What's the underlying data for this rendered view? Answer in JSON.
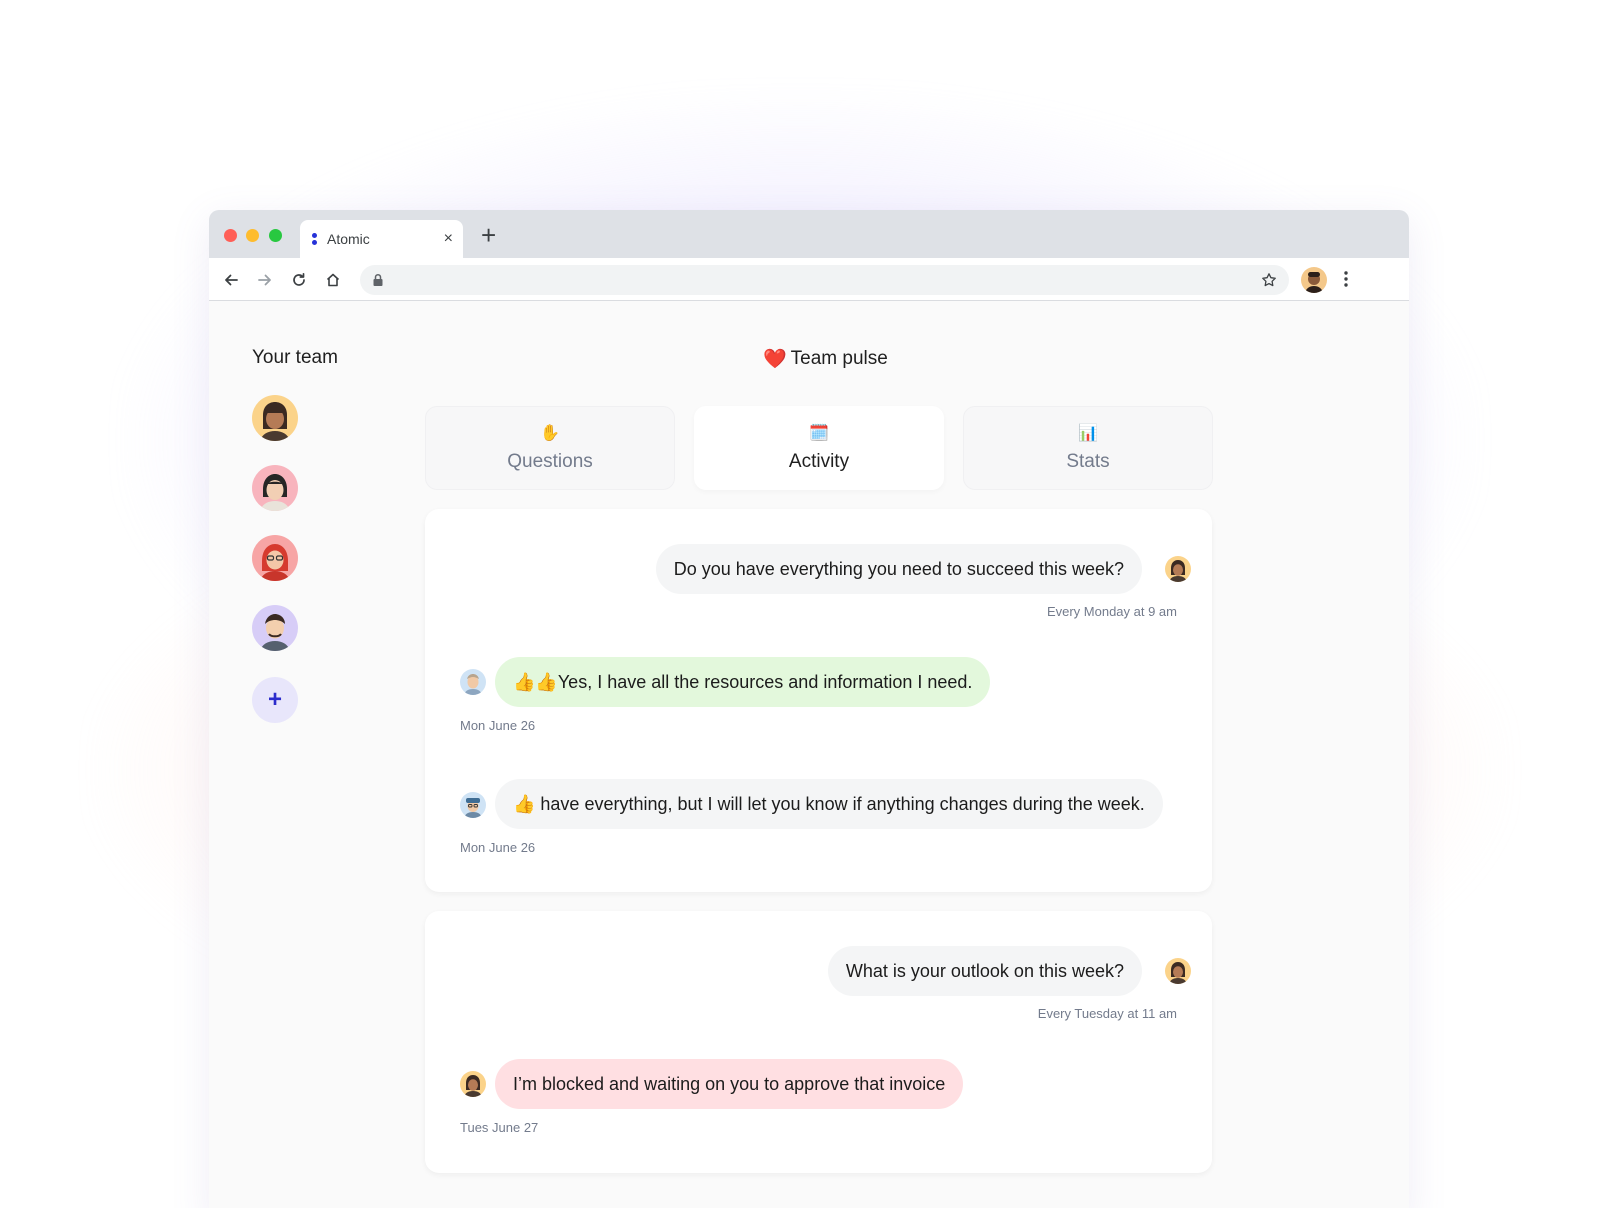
{
  "browser": {
    "tab_title": "Atomic",
    "tab_close": "×",
    "new_tab": "+"
  },
  "sidebar": {
    "title": "Your team",
    "members": [
      {
        "name": "member-1",
        "bg": "#fbd38a"
      },
      {
        "name": "member-2",
        "bg": "#f8b4bd"
      },
      {
        "name": "member-3",
        "bg": "#f7a5a5"
      },
      {
        "name": "member-4",
        "bg": "#d7cdf7"
      }
    ],
    "add_label": "+"
  },
  "main": {
    "title_emoji": "❤️",
    "title": "Team pulse",
    "tabs": [
      {
        "icon": "✋",
        "label": "Questions"
      },
      {
        "icon": "🗓️",
        "label": "Activity"
      },
      {
        "icon": "📊",
        "label": "Stats"
      }
    ]
  },
  "threads": [
    {
      "question": "Do you have everything you need to succeed this week?",
      "schedule": "Every Monday at 9 am",
      "answers": [
        {
          "text": "👍👍Yes, I have all the resources and information I need.",
          "date": "Mon June 26",
          "tone": "green"
        },
        {
          "text": "👍  have everything, but I will let you know if anything changes during the week.",
          "date": "Mon June 26",
          "tone": "grey"
        }
      ]
    },
    {
      "question": "What is your outlook on this week?",
      "schedule": "Every Tuesday at 11 am",
      "answers": [
        {
          "text": "I’m blocked and waiting on you to approve that invoice",
          "date": "Tues June 27",
          "tone": "pink"
        }
      ]
    }
  ],
  "colors": {
    "accent": "#2632d8",
    "green_bubble": "#e3f8dc",
    "pink_bubble": "#ffdfe2",
    "grey_bubble": "#f4f5f6"
  }
}
